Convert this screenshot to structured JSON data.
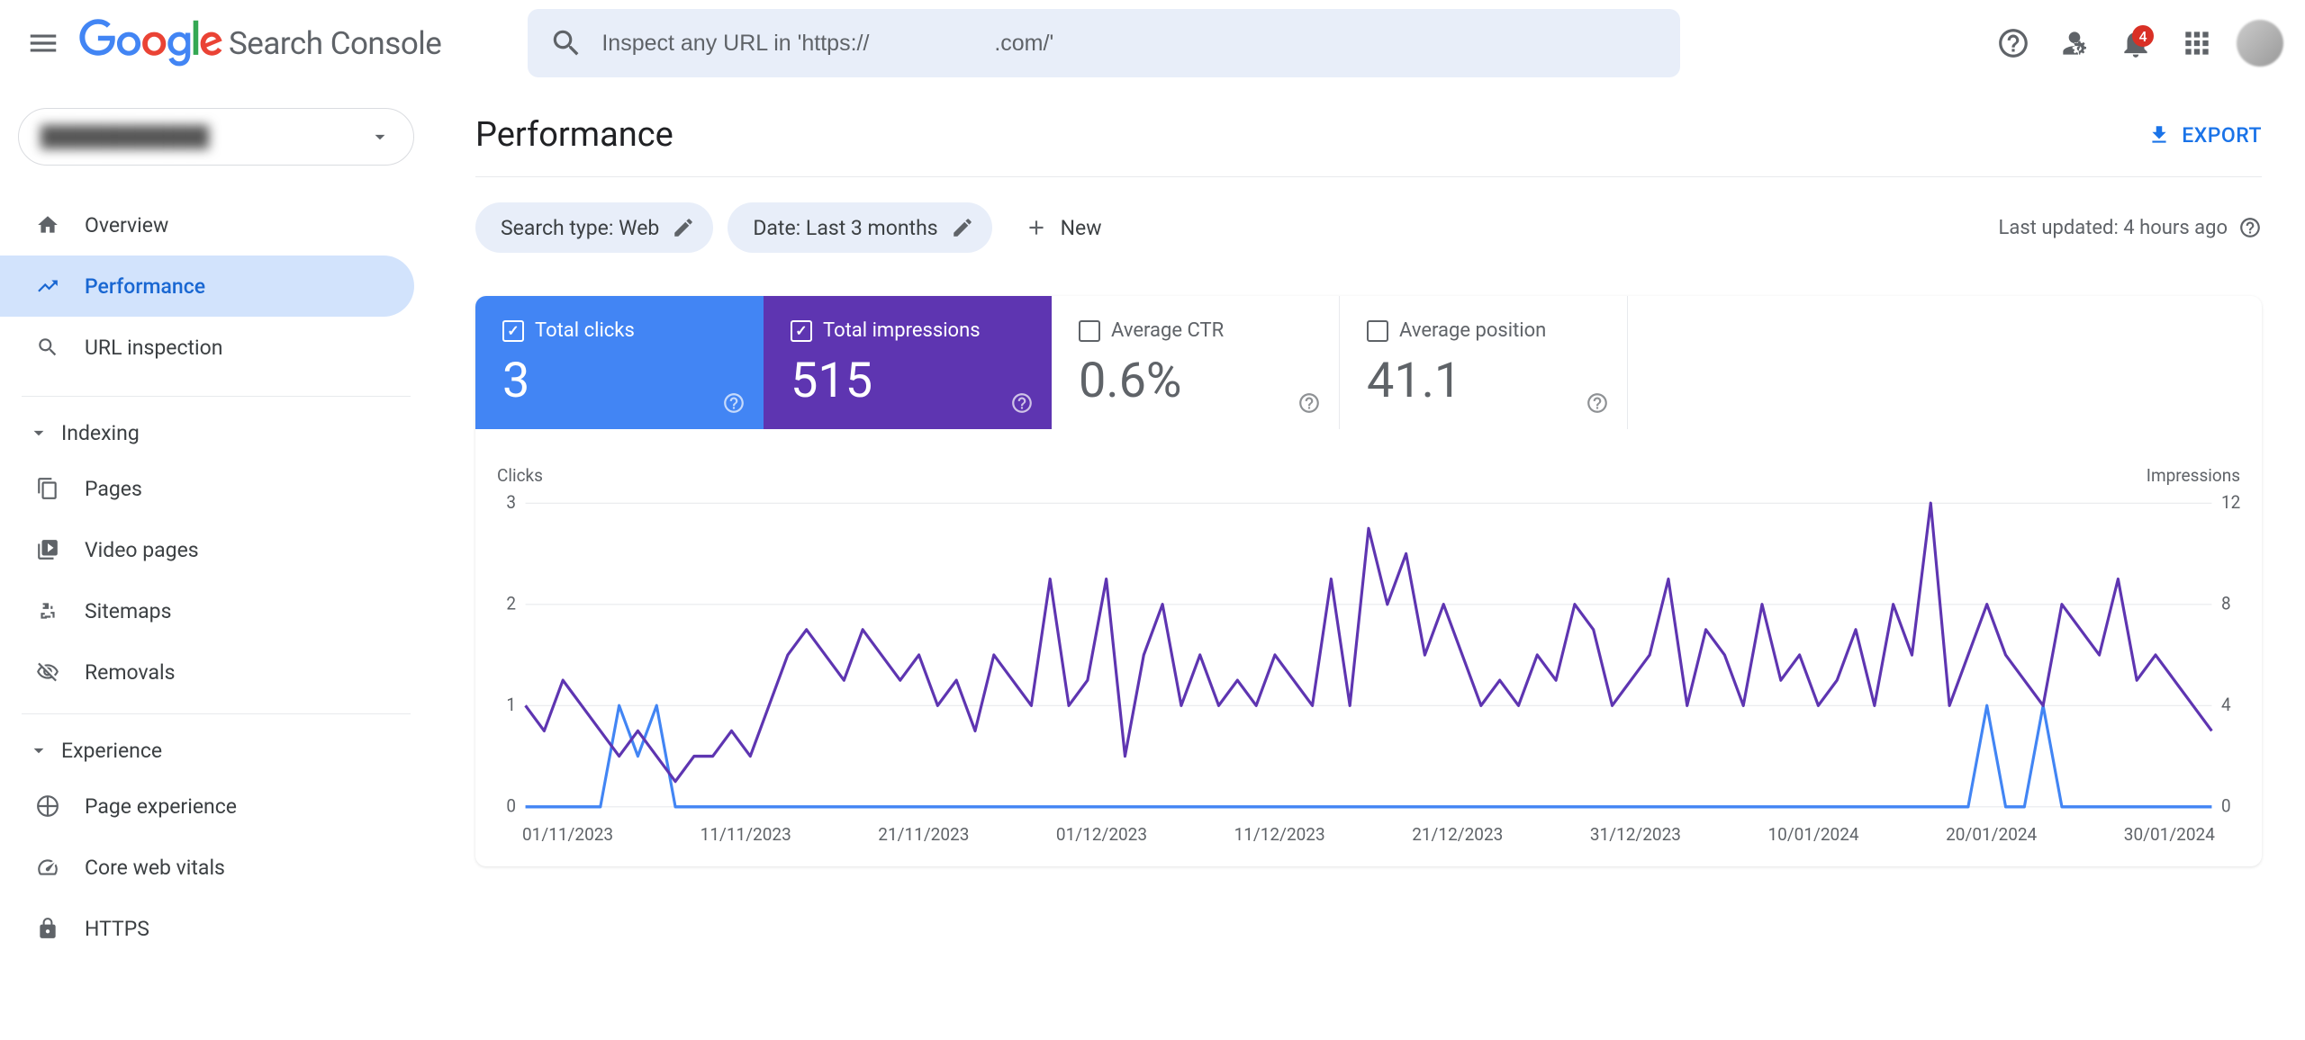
{
  "app": {
    "product_name": "Search Console",
    "search_placeholder": "Inspect any URL in 'https://                    .com/'",
    "notification_count": "4"
  },
  "sidebar": {
    "items": {
      "overview": "Overview",
      "performance": "Performance",
      "url_inspection": "URL inspection"
    },
    "groups": {
      "indexing": "Indexing",
      "experience": "Experience"
    },
    "indexing_items": {
      "pages": "Pages",
      "video_pages": "Video pages",
      "sitemaps": "Sitemaps",
      "removals": "Removals"
    },
    "experience_items": {
      "page_experience": "Page experience",
      "cwv": "Core web vitals",
      "https": "HTTPS"
    }
  },
  "page": {
    "title": "Performance",
    "export": "EXPORT",
    "filters": {
      "search_type": "Search type: Web",
      "date_range": "Date: Last 3 months",
      "add_new": "New"
    },
    "last_updated": "Last updated: 4 hours ago"
  },
  "metrics": {
    "clicks": {
      "label": "Total clicks",
      "value": "3"
    },
    "impressions": {
      "label": "Total impressions",
      "value": "515"
    },
    "ctr": {
      "label": "Average CTR",
      "value": "0.6%"
    },
    "position": {
      "label": "Average position",
      "value": "41.1"
    }
  },
  "chart_data": {
    "type": "line",
    "y_left_label": "Clicks",
    "y_right_label": "Impressions",
    "y_left_ticks": [
      0,
      1,
      2,
      3
    ],
    "y_right_ticks": [
      0,
      4,
      8,
      12
    ],
    "x_ticks": [
      "01/11/2023",
      "11/11/2023",
      "21/11/2023",
      "01/12/2023",
      "11/12/2023",
      "21/12/2023",
      "31/12/2023",
      "10/01/2024",
      "20/01/2024",
      "30/01/2024"
    ],
    "series": [
      {
        "name": "Clicks",
        "color": "#4285f4",
        "axis": "left",
        "values": [
          0,
          0,
          0,
          0,
          0,
          1,
          0.5,
          1,
          0,
          0,
          0,
          0,
          0,
          0,
          0,
          0,
          0,
          0,
          0,
          0,
          0,
          0,
          0,
          0,
          0,
          0,
          0,
          0,
          0,
          0,
          0,
          0,
          0,
          0,
          0,
          0,
          0,
          0,
          0,
          0,
          0,
          0,
          0,
          0,
          0,
          0,
          0,
          0,
          0,
          0,
          0,
          0,
          0,
          0,
          0,
          0,
          0,
          0,
          0,
          0,
          0,
          0,
          0,
          0,
          0,
          0,
          0,
          0,
          0,
          0,
          0,
          0,
          0,
          0,
          0,
          0,
          0,
          0,
          1,
          0,
          0,
          1,
          0,
          0,
          0,
          0,
          0,
          0,
          0,
          0,
          0
        ]
      },
      {
        "name": "Impressions",
        "color": "#5e35b1",
        "axis": "right",
        "values": [
          4,
          3,
          5,
          4,
          3,
          2,
          3,
          2,
          1,
          2,
          2,
          3,
          2,
          4,
          6,
          7,
          6,
          5,
          7,
          6,
          5,
          6,
          4,
          5,
          3,
          6,
          5,
          4,
          9,
          4,
          5,
          9,
          2,
          6,
          8,
          4,
          6,
          4,
          5,
          4,
          6,
          5,
          4,
          9,
          4,
          11,
          8,
          10,
          6,
          8,
          6,
          4,
          5,
          4,
          6,
          5,
          8,
          7,
          4,
          5,
          6,
          9,
          4,
          7,
          6,
          4,
          8,
          5,
          6,
          4,
          5,
          7,
          4,
          8,
          6,
          12,
          4,
          6,
          8,
          6,
          5,
          4,
          8,
          7,
          6,
          9,
          5,
          6,
          5,
          4,
          3
        ]
      }
    ]
  }
}
